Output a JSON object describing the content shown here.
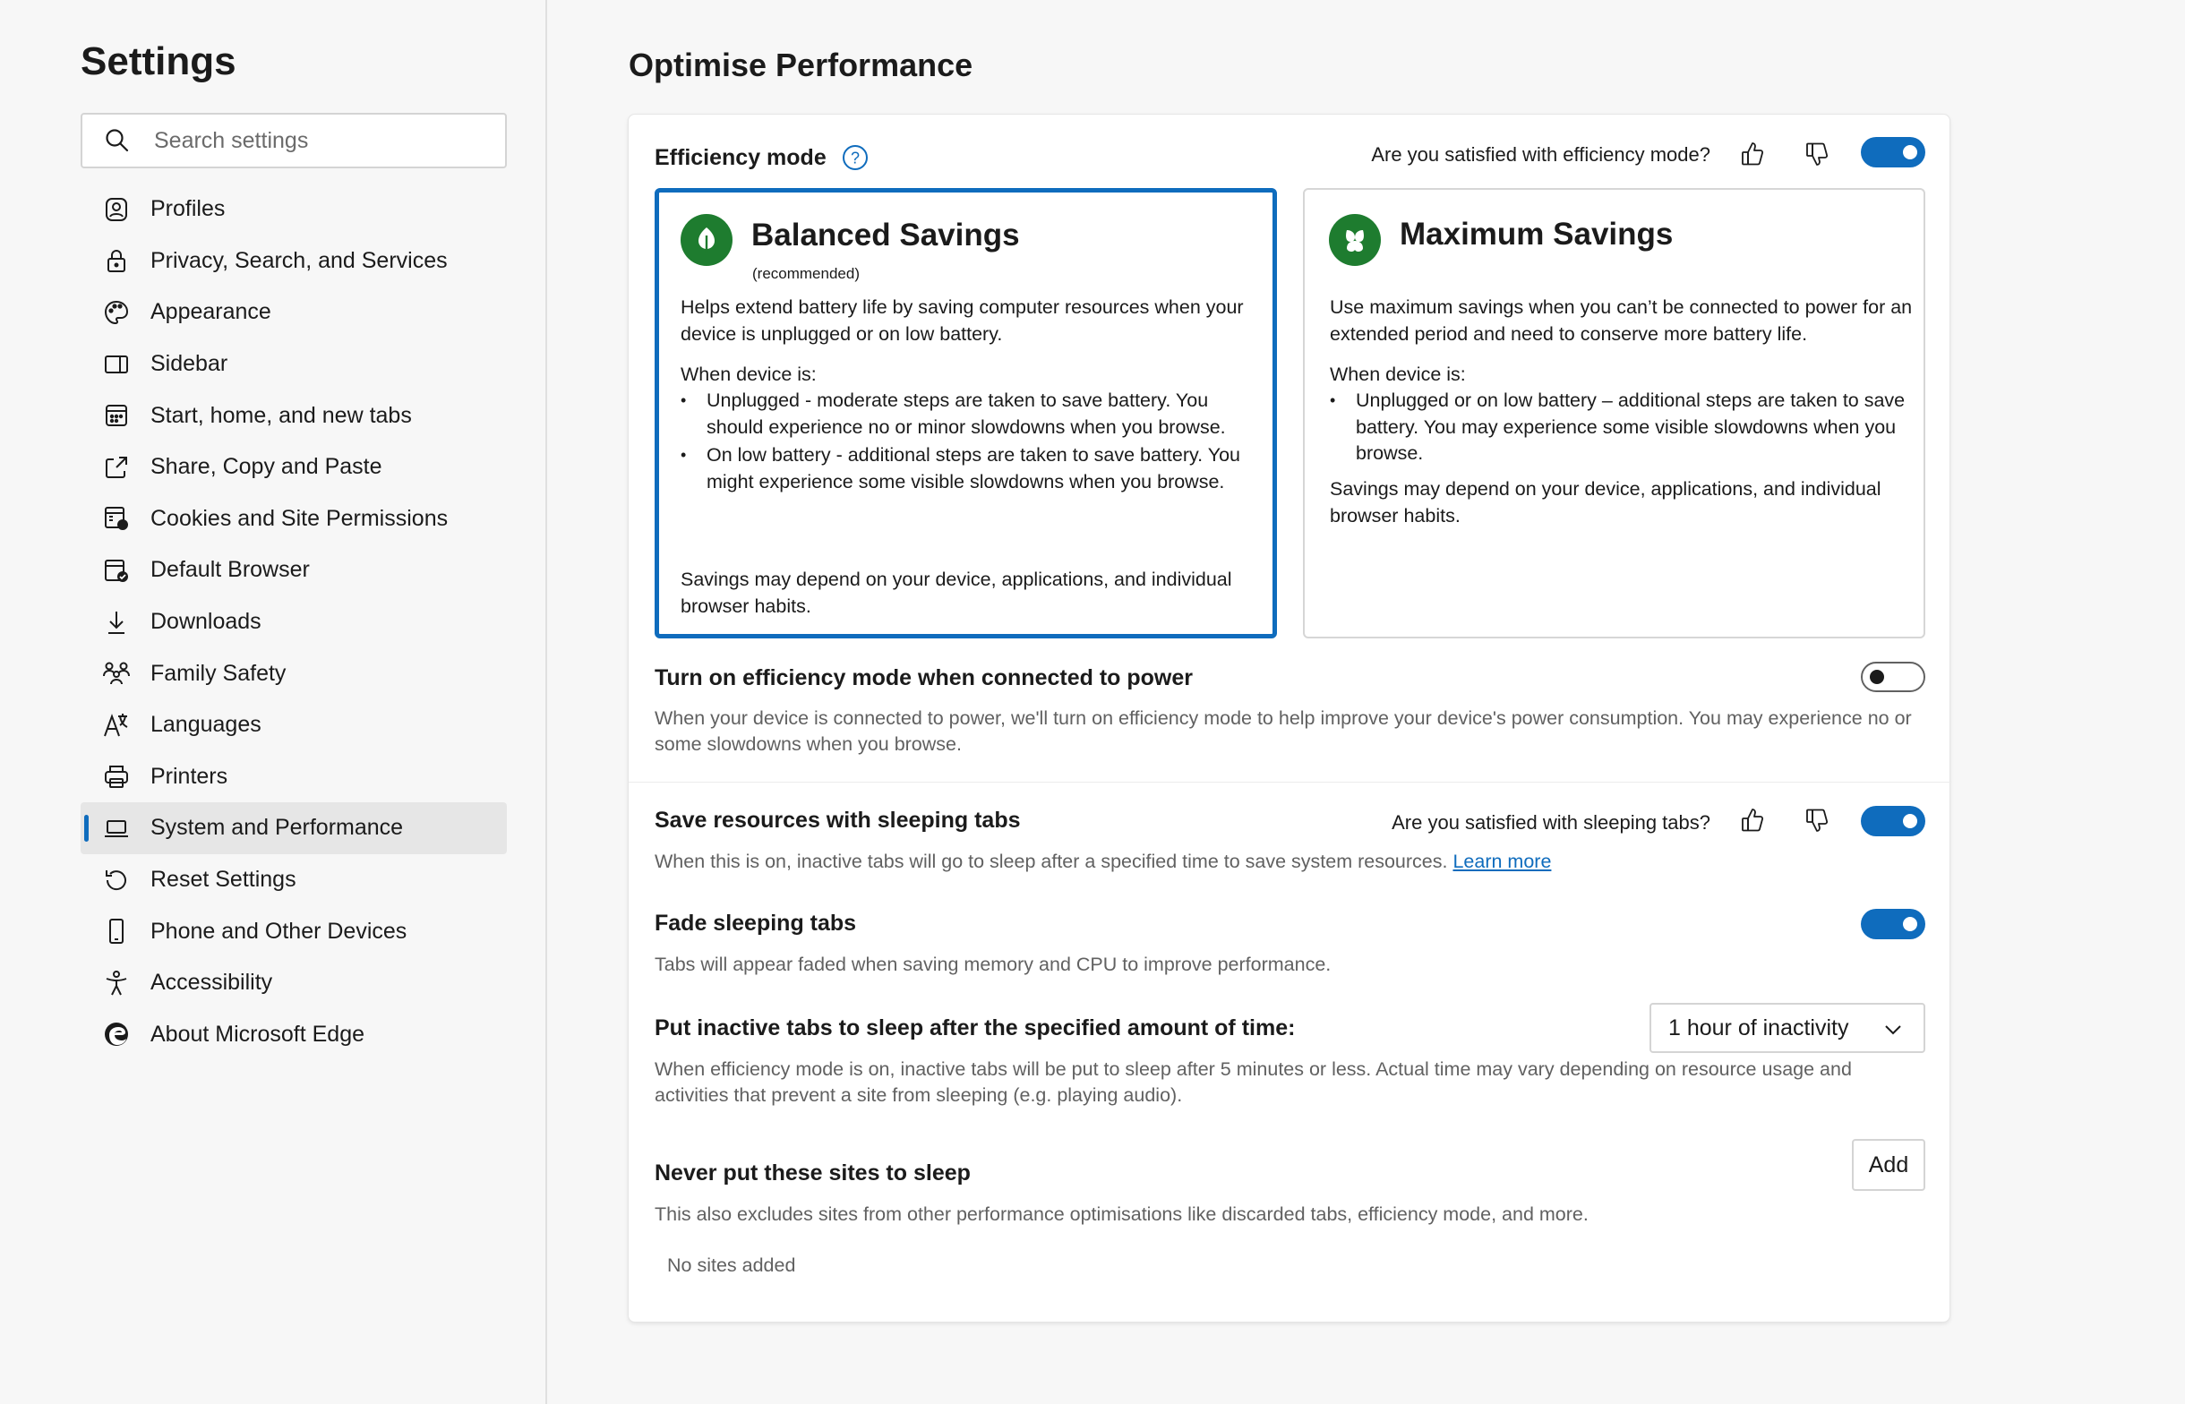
{
  "sidebar": {
    "title": "Settings",
    "search_placeholder": "Search settings",
    "items": [
      {
        "label": "Profiles",
        "icon": "profile-icon"
      },
      {
        "label": "Privacy, Search, and Services",
        "icon": "lock-icon"
      },
      {
        "label": "Appearance",
        "icon": "palette-icon"
      },
      {
        "label": "Sidebar",
        "icon": "sidebar-icon"
      },
      {
        "label": "Start, home, and new tabs",
        "icon": "home-grid-icon"
      },
      {
        "label": "Share, Copy and Paste",
        "icon": "share-icon"
      },
      {
        "label": "Cookies and Site Permissions",
        "icon": "cookie-gear-icon"
      },
      {
        "label": "Default Browser",
        "icon": "default-browser-icon"
      },
      {
        "label": "Downloads",
        "icon": "download-icon"
      },
      {
        "label": "Family Safety",
        "icon": "family-icon"
      },
      {
        "label": "Languages",
        "icon": "languages-icon"
      },
      {
        "label": "Printers",
        "icon": "printer-icon"
      },
      {
        "label": "System and Performance",
        "icon": "laptop-icon",
        "active": true
      },
      {
        "label": "Reset Settings",
        "icon": "reset-icon"
      },
      {
        "label": "Phone and Other Devices",
        "icon": "phone-icon"
      },
      {
        "label": "Accessibility",
        "icon": "accessibility-icon"
      },
      {
        "label": "About Microsoft Edge",
        "icon": "edge-logo-icon"
      }
    ]
  },
  "main": {
    "page_title": "Optimise Performance",
    "efficiency": {
      "label": "Efficiency mode",
      "feedback_question": "Are you satisfied with efficiency mode?",
      "toggle_on": true,
      "balanced": {
        "title": "Balanced Savings",
        "subtitle": "(recommended)",
        "intro": "Helps extend battery life by saving computer resources when your device is unplugged or on low battery.",
        "when_label": "When device is:",
        "bullets": [
          "Unplugged - moderate steps are taken to save battery. You should experience no or minor slowdowns when you browse.",
          "On low battery - additional steps are taken to save battery. You might experience some visible slowdowns when you browse."
        ],
        "footer": "Savings may depend on your device, applications, and individual browser habits.",
        "selected": true
      },
      "maximum": {
        "title": "Maximum Savings",
        "intro": "Use maximum savings when you can’t be connected to power for an extended period and need to conserve more battery life.",
        "when_label": "When device is:",
        "bullets": [
          "Unplugged or on low battery – additional steps are taken to save battery. You may experience some visible slowdowns when you browse."
        ],
        "footer": "Savings may depend on your device, applications, and individual browser habits.",
        "selected": false
      }
    },
    "power": {
      "label": "Turn on efficiency mode when connected to power",
      "description": "When your device is connected to power, we'll turn on efficiency mode to help improve your device's power consumption. You may experience no or some slowdowns when you browse.",
      "toggle_on": false
    },
    "sleeping_tabs": {
      "label": "Save resources with sleeping tabs",
      "feedback_question": "Are you satisfied with sleeping tabs?",
      "description": "When this is on, inactive tabs will go to sleep after a specified time to save system resources.",
      "learn_more": "Learn more",
      "toggle_on": true
    },
    "fade": {
      "label": "Fade sleeping tabs",
      "description": "Tabs will appear faded when saving memory and CPU to improve performance.",
      "toggle_on": true
    },
    "inactive": {
      "label": "Put inactive tabs to sleep after the specified amount of time:",
      "selected_value": "1 hour of inactivity",
      "description": "When efficiency mode is on, inactive tabs will be put to sleep after 5 minutes or less. Actual time may vary depending on resource usage and activities that prevent a site from sleeping (e.g. playing audio)."
    },
    "never_sleep": {
      "label": "Never put these sites to sleep",
      "add_label": "Add",
      "description": "This also excludes sites from other performance optimisations like discarded tabs, efficiency mode, and more.",
      "empty_text": "No sites added"
    }
  },
  "colors": {
    "accent": "#0f6cbd",
    "leaf_green": "#1e7c2f"
  }
}
